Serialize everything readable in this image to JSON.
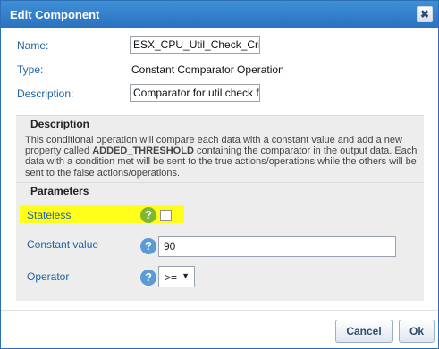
{
  "dialog": {
    "title": "Edit Component",
    "close_label": "✖"
  },
  "fields": {
    "name_label": "Name:",
    "name_value": "ESX_CPU_Util_Check_Critica",
    "type_label": "Type:",
    "type_value": "Constant Comparator Operation",
    "description_label": "Description:",
    "description_value": "Comparator for util check for"
  },
  "description_section": {
    "title": "Description",
    "text_part1": "This conditional operation will compare each data with a constant value and add a new property called ",
    "text_bold": "ADDED_THRESHOLD",
    "text_part2": " containing the comparator in the output data. Each data with a condition met will be sent to the true actions/operations while the others will be sent to the false actions/operations."
  },
  "parameters_section": {
    "title": "Parameters",
    "stateless_label": "Stateless",
    "stateless_checked": false,
    "constant_label": "Constant value",
    "constant_value": "90",
    "operator_label": "Operator",
    "operator_value": ">=",
    "help_glyph": "?",
    "colors": {
      "highlight": "#ffff19",
      "help_green": "#7fb734",
      "help_blue": "#5a9ad6"
    }
  },
  "buttons": {
    "cancel": "Cancel",
    "ok": "Ok"
  },
  "icons": {
    "close": "close-icon",
    "help": "help-icon",
    "dropdown": "chevron-down-icon"
  }
}
